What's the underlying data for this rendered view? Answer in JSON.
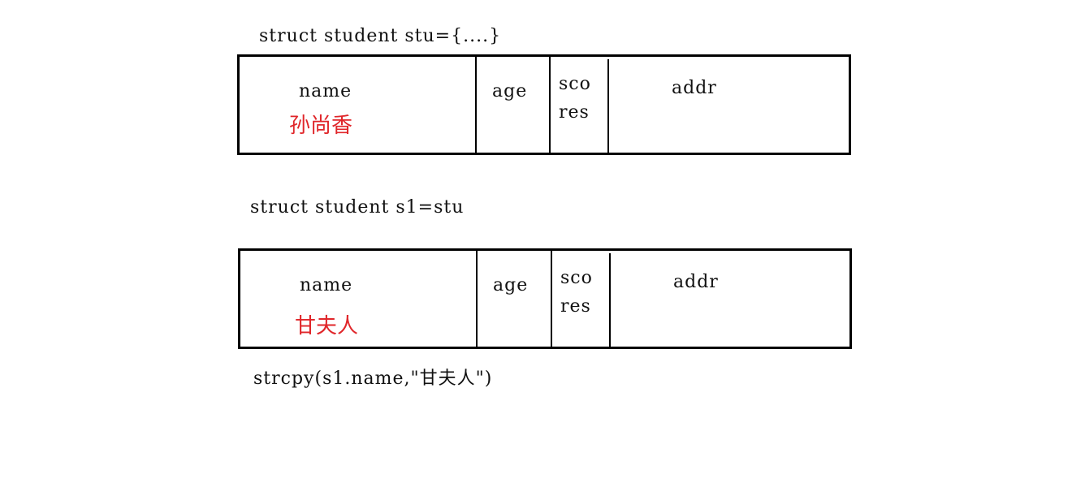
{
  "line1": "struct student stu={....}",
  "box1": {
    "name_label": "name",
    "name_value": "孙尚香",
    "age_label": "age",
    "scores_label_line1": "sco",
    "scores_label_line2": "res",
    "addr_label": "addr"
  },
  "line2": "struct student s1=stu",
  "box2": {
    "name_label": "name",
    "name_value": "甘夫人",
    "age_label": "age",
    "scores_label_line1": "sco",
    "scores_label_line2": "res",
    "addr_label": "addr"
  },
  "line3": "strcpy(s1.name,\"甘夫人\")",
  "colors": {
    "value_red": "#e0262a",
    "border": "#000000",
    "text": "#111111"
  }
}
